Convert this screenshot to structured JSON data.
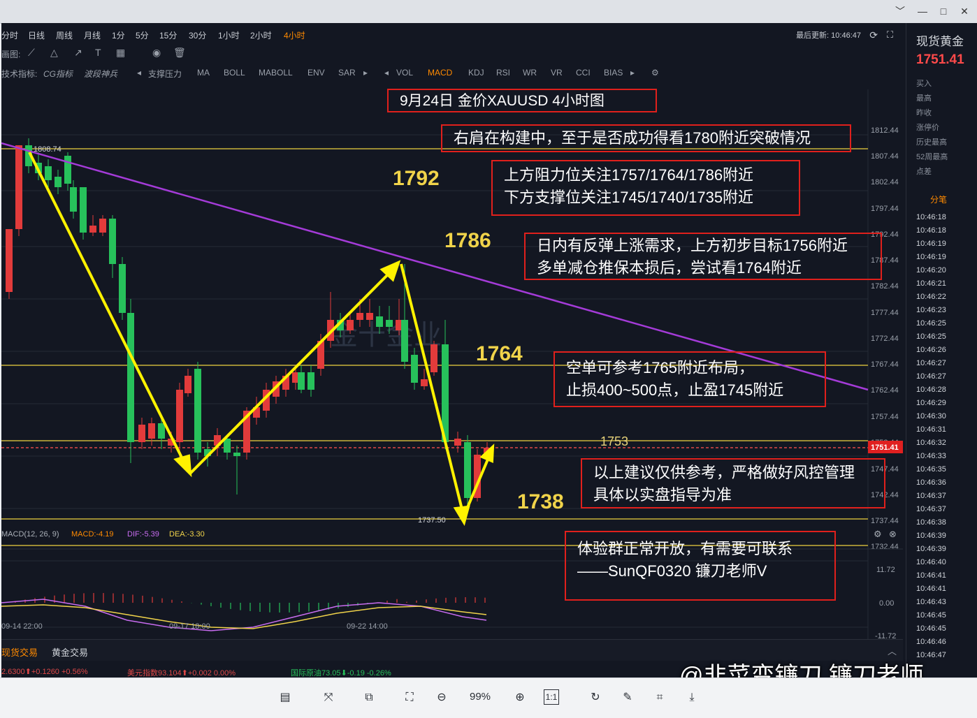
{
  "window": {
    "controls": [
      "﹀",
      "—",
      "□",
      "✕"
    ]
  },
  "toolbar": {
    "timeframes": [
      "分时",
      "日线",
      "周线",
      "月线",
      "1分",
      "5分",
      "15分",
      "30分",
      "1小时",
      "2小时",
      "4小时"
    ],
    "active_timeframe": "4小时",
    "last_update": "最后更新: 10:46:47",
    "draw_label": "画图:",
    "indicator_label": "技术指标:",
    "indicators": [
      "CG指标",
      "波段神兵",
      "支撑压力",
      "MA",
      "BOLL",
      "MABOLL",
      "ENV",
      "SAR",
      "VOL",
      "MACD",
      "KDJ",
      "RSI",
      "WR",
      "VR",
      "CCI",
      "BIAS"
    ],
    "active_indicator": "MACD"
  },
  "chart": {
    "price_axis": [
      "1812.44",
      "1807.44",
      "1802.44",
      "1797.44",
      "1792.44",
      "1787.44",
      "1782.44",
      "1777.44",
      "1772.44",
      "1767.44",
      "1762.44",
      "1757.44",
      "1752.44",
      "1747.44",
      "1742.44",
      "1737.44",
      "1732.44"
    ],
    "current_price_tag": "1751.41",
    "high_label": "1808.74",
    "low_label": "1737.50",
    "time_axis": [
      "09-14 22:00",
      "09-17 18:00",
      "09-22 14:00"
    ],
    "macd_axis": [
      "11.72",
      "0.00",
      "-11.72"
    ],
    "macd_legend": {
      "name": "MACD(12, 26, 9)",
      "macd": "MACD:-4.19",
      "dif": "DIF:-5.39",
      "dea": "DEA:-3.30"
    },
    "levels": {
      "l1792": "1792",
      "l1786": "1786",
      "l1764": "1764",
      "l1753": "1753",
      "l1738": "1738"
    },
    "watermark_brand": "金十金业",
    "colors": {
      "up": "#e23b3b",
      "down": "#27c15b",
      "trend": "#a43bd8",
      "arrow": "#fff200",
      "level": "#c9b43a"
    }
  },
  "annotations": {
    "title": "9月24日 金价XAUUSD 4小时图",
    "a1": "右肩在构建中，至于是否成功得看1780附近突破情况",
    "a2_l1": "上方阻力位关注1757/1764/1786附近",
    "a2_l2": "下方支撑位关注1745/1740/1735附近",
    "a3_l1": "日内有反弹上涨需求，上方初步目标1756附近",
    "a3_l2": "多单减仓推保本损后，尝试看1764附近",
    "a4_l1": "空单可参考1765附近布局，",
    "a4_l2": "止损400~500点，止盈1745附近",
    "a5_l1": "以上建议仅供参考，严格做好风控管理",
    "a5_l2": "具体以实盘指导为准",
    "a6_l1": "体验群正常开放，有需要可联系",
    "a6_l2": "——SunQF0320  镰刀老师V"
  },
  "right_panel": {
    "title": "现货黄金",
    "price": "1751.41",
    "labels": [
      "买入",
      "最高",
      "昨收",
      "涨停价",
      "历史最高",
      "52周最高",
      "点差"
    ],
    "ticks_header": "分笔",
    "ticks": [
      "10:46:18",
      "10:46:18",
      "10:46:19",
      "10:46:19",
      "10:46:20",
      "10:46:21",
      "10:46:22",
      "10:46:23",
      "10:46:25",
      "10:46:25",
      "10:46:26",
      "10:46:27",
      "10:46:27",
      "10:46:28",
      "10:46:29",
      "10:46:30",
      "10:46:31",
      "10:46:32",
      "10:46:33",
      "10:46:35",
      "10:46:36",
      "10:46:37",
      "10:46:37",
      "10:46:38",
      "10:46:39",
      "10:46:39",
      "10:46:40",
      "10:46:41",
      "10:46:41",
      "10:46:43",
      "10:46:45",
      "10:46:45",
      "10:46:46",
      "10:46:47"
    ]
  },
  "bottom_tabs": [
    "现货交易",
    "黄金交易"
  ],
  "ticker": {
    "t1": "2.6300⬆+0.1260 +0.56%",
    "t2": "美元指数93.104⬆+0.002 0.00%",
    "t3": "国际原油73.05⬇-0.19 -0.26%"
  },
  "viewer": {
    "zoom": "99%"
  },
  "watermark": "@韭菜变镰刀 镰刀老师"
}
